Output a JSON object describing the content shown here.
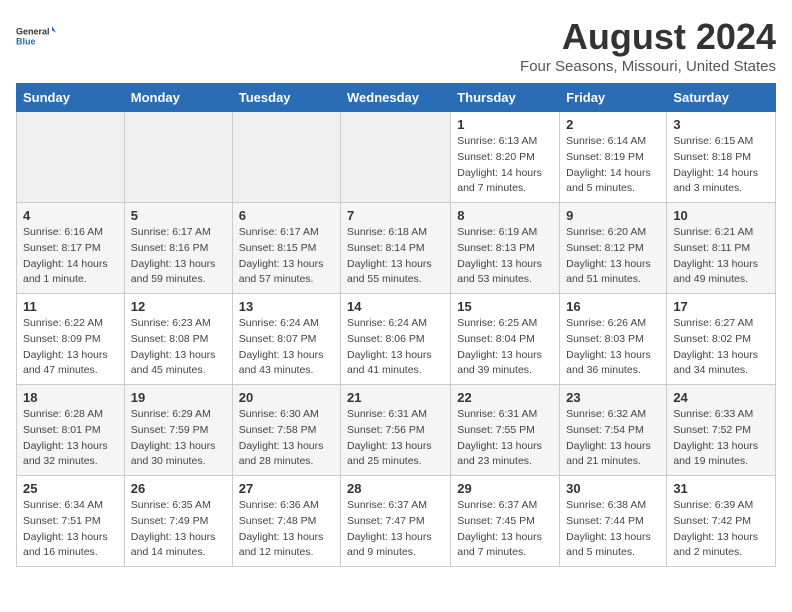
{
  "header": {
    "logo_general": "General",
    "logo_blue": "Blue",
    "main_title": "August 2024",
    "subtitle": "Four Seasons, Missouri, United States"
  },
  "days_of_week": [
    "Sunday",
    "Monday",
    "Tuesday",
    "Wednesday",
    "Thursday",
    "Friday",
    "Saturday"
  ],
  "weeks": [
    [
      {
        "day": "",
        "empty": true
      },
      {
        "day": "",
        "empty": true
      },
      {
        "day": "",
        "empty": true
      },
      {
        "day": "",
        "empty": true
      },
      {
        "day": "1",
        "sunrise": "6:13 AM",
        "sunset": "8:20 PM",
        "daylight": "14 hours and 7 minutes."
      },
      {
        "day": "2",
        "sunrise": "6:14 AM",
        "sunset": "8:19 PM",
        "daylight": "14 hours and 5 minutes."
      },
      {
        "day": "3",
        "sunrise": "6:15 AM",
        "sunset": "8:18 PM",
        "daylight": "14 hours and 3 minutes."
      }
    ],
    [
      {
        "day": "4",
        "sunrise": "6:16 AM",
        "sunset": "8:17 PM",
        "daylight": "14 hours and 1 minute."
      },
      {
        "day": "5",
        "sunrise": "6:17 AM",
        "sunset": "8:16 PM",
        "daylight": "13 hours and 59 minutes."
      },
      {
        "day": "6",
        "sunrise": "6:17 AM",
        "sunset": "8:15 PM",
        "daylight": "13 hours and 57 minutes."
      },
      {
        "day": "7",
        "sunrise": "6:18 AM",
        "sunset": "8:14 PM",
        "daylight": "13 hours and 55 minutes."
      },
      {
        "day": "8",
        "sunrise": "6:19 AM",
        "sunset": "8:13 PM",
        "daylight": "13 hours and 53 minutes."
      },
      {
        "day": "9",
        "sunrise": "6:20 AM",
        "sunset": "8:12 PM",
        "daylight": "13 hours and 51 minutes."
      },
      {
        "day": "10",
        "sunrise": "6:21 AM",
        "sunset": "8:11 PM",
        "daylight": "13 hours and 49 minutes."
      }
    ],
    [
      {
        "day": "11",
        "sunrise": "6:22 AM",
        "sunset": "8:09 PM",
        "daylight": "13 hours and 47 minutes."
      },
      {
        "day": "12",
        "sunrise": "6:23 AM",
        "sunset": "8:08 PM",
        "daylight": "13 hours and 45 minutes."
      },
      {
        "day": "13",
        "sunrise": "6:24 AM",
        "sunset": "8:07 PM",
        "daylight": "13 hours and 43 minutes."
      },
      {
        "day": "14",
        "sunrise": "6:24 AM",
        "sunset": "8:06 PM",
        "daylight": "13 hours and 41 minutes."
      },
      {
        "day": "15",
        "sunrise": "6:25 AM",
        "sunset": "8:04 PM",
        "daylight": "13 hours and 39 minutes."
      },
      {
        "day": "16",
        "sunrise": "6:26 AM",
        "sunset": "8:03 PM",
        "daylight": "13 hours and 36 minutes."
      },
      {
        "day": "17",
        "sunrise": "6:27 AM",
        "sunset": "8:02 PM",
        "daylight": "13 hours and 34 minutes."
      }
    ],
    [
      {
        "day": "18",
        "sunrise": "6:28 AM",
        "sunset": "8:01 PM",
        "daylight": "13 hours and 32 minutes."
      },
      {
        "day": "19",
        "sunrise": "6:29 AM",
        "sunset": "7:59 PM",
        "daylight": "13 hours and 30 minutes."
      },
      {
        "day": "20",
        "sunrise": "6:30 AM",
        "sunset": "7:58 PM",
        "daylight": "13 hours and 28 minutes."
      },
      {
        "day": "21",
        "sunrise": "6:31 AM",
        "sunset": "7:56 PM",
        "daylight": "13 hours and 25 minutes."
      },
      {
        "day": "22",
        "sunrise": "6:31 AM",
        "sunset": "7:55 PM",
        "daylight": "13 hours and 23 minutes."
      },
      {
        "day": "23",
        "sunrise": "6:32 AM",
        "sunset": "7:54 PM",
        "daylight": "13 hours and 21 minutes."
      },
      {
        "day": "24",
        "sunrise": "6:33 AM",
        "sunset": "7:52 PM",
        "daylight": "13 hours and 19 minutes."
      }
    ],
    [
      {
        "day": "25",
        "sunrise": "6:34 AM",
        "sunset": "7:51 PM",
        "daylight": "13 hours and 16 minutes."
      },
      {
        "day": "26",
        "sunrise": "6:35 AM",
        "sunset": "7:49 PM",
        "daylight": "13 hours and 14 minutes."
      },
      {
        "day": "27",
        "sunrise": "6:36 AM",
        "sunset": "7:48 PM",
        "daylight": "13 hours and 12 minutes."
      },
      {
        "day": "28",
        "sunrise": "6:37 AM",
        "sunset": "7:47 PM",
        "daylight": "13 hours and 9 minutes."
      },
      {
        "day": "29",
        "sunrise": "6:37 AM",
        "sunset": "7:45 PM",
        "daylight": "13 hours and 7 minutes."
      },
      {
        "day": "30",
        "sunrise": "6:38 AM",
        "sunset": "7:44 PM",
        "daylight": "13 hours and 5 minutes."
      },
      {
        "day": "31",
        "sunrise": "6:39 AM",
        "sunset": "7:42 PM",
        "daylight": "13 hours and 2 minutes."
      }
    ]
  ],
  "labels": {
    "sunrise": "Sunrise:",
    "sunset": "Sunset:",
    "daylight": "Daylight:"
  }
}
